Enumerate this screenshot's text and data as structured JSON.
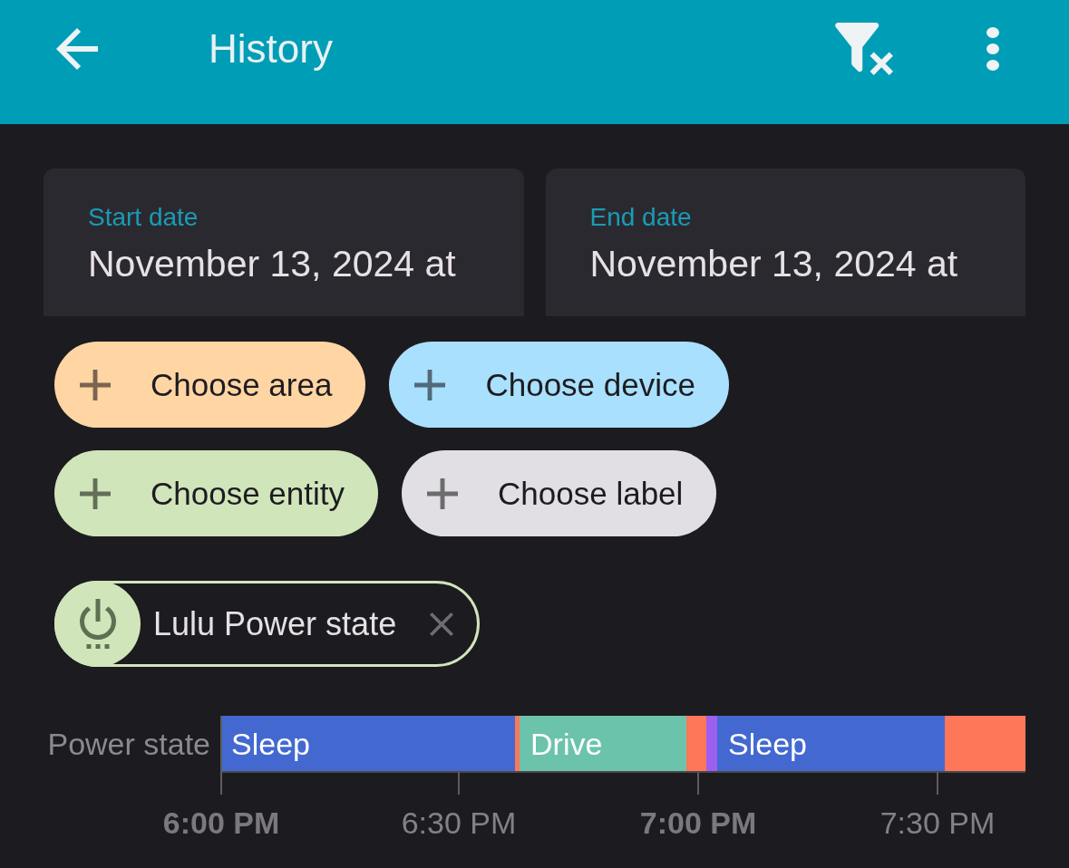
{
  "app_bar": {
    "title": "History"
  },
  "date_range": [
    {
      "label": "Start date",
      "value": "November 13, 2024 at"
    },
    {
      "label": "End date",
      "value": "November 13, 2024 at"
    }
  ],
  "target_pickers": [
    {
      "label": "Choose area",
      "color": "#ffd5a4"
    },
    {
      "label": "Choose device",
      "color": "#a9e0fd"
    },
    {
      "label": "Choose entity",
      "color": "#d1e5ba"
    },
    {
      "label": "Choose label",
      "color": "#e1dfe3"
    }
  ],
  "selected_targets": [
    {
      "label": "Lulu Power state"
    }
  ],
  "timeline": {
    "row_label": "Power state",
    "segments": [
      {
        "label": "Sleep",
        "color": "#4369d1"
      },
      {
        "color": "#ff7759"
      },
      {
        "label": "Drive",
        "color": "#6cc3ac"
      },
      {
        "color": "#ff7759"
      },
      {
        "color": "#9c5ff0"
      },
      {
        "label": "Sleep",
        "color": "#4369d1"
      },
      {
        "color": "#ff7759"
      }
    ],
    "ticks": [
      {
        "label": "6:00 PM",
        "major": true
      },
      {
        "label": "6:30 PM",
        "major": false
      },
      {
        "label": "7:00 PM",
        "major": true
      },
      {
        "label": "7:30 PM",
        "major": false
      }
    ]
  }
}
